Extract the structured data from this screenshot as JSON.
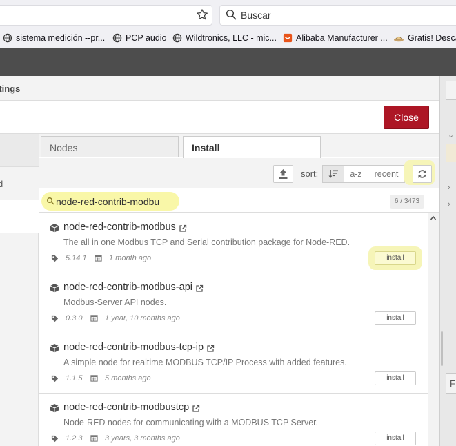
{
  "browser": {
    "search_placeholder": "Buscar",
    "bookmarks": [
      {
        "label": "sistema medición --pr...",
        "icon": "globe-icon"
      },
      {
        "label": "PCP audio",
        "icon": "globe-icon"
      },
      {
        "label": "Wildtronics, LLC - mic...",
        "icon": "globe-icon"
      },
      {
        "label": "Alibaba Manufacturer ...",
        "icon": "alibaba-icon"
      },
      {
        "label": "Gratis! Descar",
        "icon": "coffee-icon"
      }
    ]
  },
  "dialog": {
    "title": "ttings",
    "close_label": "Close",
    "nav_item_2": "d"
  },
  "tabs": [
    {
      "label": "Nodes",
      "active": false
    },
    {
      "label": "Install",
      "active": true
    }
  ],
  "toolbar": {
    "sort_label": "sort:",
    "sort_options": [
      "a-z",
      "recent"
    ]
  },
  "filter": {
    "value": "node-red-contrib-modbu",
    "count": "6 / 3473"
  },
  "results": [
    {
      "name": "node-red-contrib-modbus",
      "description": "The all in one Modbus TCP and Serial contribution package for Node-RED.",
      "version": "5.14.1",
      "updated": "1 month ago",
      "install_label": "install"
    },
    {
      "name": "node-red-contrib-modbus-api",
      "description": "Modbus-Server API nodes.",
      "version": "0.3.0",
      "updated": "1 year, 10 months ago",
      "install_label": "install"
    },
    {
      "name": "node-red-contrib-modbus-tcp-ip",
      "description": "A simple node for realtime MODBUS TCP/IP Process with added features.",
      "version": "1.1.5",
      "updated": "5 months ago",
      "install_label": "install"
    },
    {
      "name": "node-red-contrib-modbustcp",
      "description": "Node-RED nodes for communicating with a MODBUS TCP Server.",
      "version": "1.2.3",
      "updated": "3 years, 3 months ago",
      "install_label": "install"
    }
  ],
  "sidebar_strip": {
    "letter": "F"
  },
  "colors": {
    "close_button": "#ad1625",
    "highlight": "#f9f7a8",
    "header": "#4d4d4d"
  }
}
